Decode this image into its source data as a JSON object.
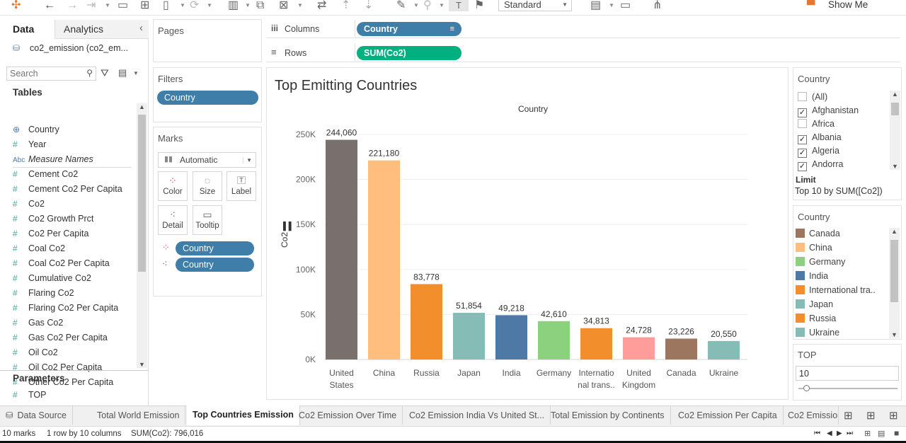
{
  "toolbar": {
    "fit_select": "Standard",
    "show_me": "Show Me"
  },
  "data_pane": {
    "tabs": [
      "Data",
      "Analytics"
    ],
    "datasource": "co2_emission (co2_em...",
    "search_placeholder": "Search",
    "tables_heading": "Tables",
    "fields": [
      {
        "type": "geo",
        "name": "Country"
      },
      {
        "type": "#",
        "name": "Year"
      },
      {
        "type": "Abc",
        "name": "Measure Names"
      },
      {
        "type": "#",
        "name": "Cement Co2"
      },
      {
        "type": "#",
        "name": "Cement Co2 Per Capita"
      },
      {
        "type": "#",
        "name": "Co2"
      },
      {
        "type": "#",
        "name": "Co2 Growth Prct"
      },
      {
        "type": "#",
        "name": "Co2 Per Capita"
      },
      {
        "type": "#",
        "name": "Coal Co2"
      },
      {
        "type": "#",
        "name": "Coal Co2 Per Capita"
      },
      {
        "type": "#",
        "name": "Cumulative Co2"
      },
      {
        "type": "#",
        "name": "Flaring Co2"
      },
      {
        "type": "#",
        "name": "Flaring Co2 Per Capita"
      },
      {
        "type": "#",
        "name": "Gas Co2"
      },
      {
        "type": "#",
        "name": "Gas Co2 Per Capita"
      },
      {
        "type": "#",
        "name": "Oil Co2"
      },
      {
        "type": "#",
        "name": "Oil Co2 Per Capita"
      },
      {
        "type": "#",
        "name": "Other Co2 Per Capita"
      }
    ],
    "parameters_heading": "Parameters",
    "parameters": [
      {
        "type": "#",
        "name": "TOP"
      }
    ]
  },
  "pages_label": "Pages",
  "filters_label": "Filters",
  "filters_pill": "Country",
  "marks": {
    "label": "Marks",
    "type": "Automatic",
    "buttons": [
      "Color",
      "Size",
      "Label",
      "Detail",
      "Tooltip"
    ],
    "pills": [
      "Country",
      "Country"
    ]
  },
  "shelves": {
    "columns_label": "Columns",
    "columns_pill": "Country",
    "rows_label": "Rows",
    "rows_pill": "SUM(Co2)"
  },
  "chart_data": {
    "type": "bar",
    "title": "Top Emitting Countries",
    "header": "Country",
    "ylabel": "Co2",
    "ylim": [
      0,
      250000
    ],
    "yticks": [
      "0K",
      "50K",
      "100K",
      "150K",
      "200K",
      "250K"
    ],
    "categories": [
      "United States",
      "China",
      "Russia",
      "Japan",
      "India",
      "Germany",
      "International trans..",
      "United Kingdom",
      "Canada",
      "Ukraine"
    ],
    "category_lines": [
      [
        "United",
        "States"
      ],
      [
        "China"
      ],
      [
        "Russia"
      ],
      [
        "Japan"
      ],
      [
        "India"
      ],
      [
        "Germany"
      ],
      [
        "Internatio",
        "nal trans.."
      ],
      [
        "United",
        "Kingdom"
      ],
      [
        "Canada"
      ],
      [
        "Ukraine"
      ]
    ],
    "values": [
      244060,
      221180,
      83778,
      51854,
      49218,
      42610,
      34813,
      24728,
      23226,
      20550
    ],
    "labels": [
      "244,060",
      "221,180",
      "83,778",
      "51,854",
      "49,218",
      "42,610",
      "34,813",
      "24,728",
      "23,226",
      "20,550"
    ],
    "colors": [
      "#79706e",
      "#ffbe7d",
      "#f28e2b",
      "#86bcb6",
      "#4e79a7",
      "#8cd17d",
      "#f28e2b",
      "#ff9d9a",
      "#9d7660",
      "#86bcb6"
    ]
  },
  "filter_card": {
    "title": "Country",
    "items": [
      {
        "label": "(All)",
        "checked": false
      },
      {
        "label": "Afghanistan",
        "checked": true
      },
      {
        "label": "Africa",
        "checked": false
      },
      {
        "label": "Albania",
        "checked": true
      },
      {
        "label": "Algeria",
        "checked": true
      },
      {
        "label": "Andorra",
        "checked": true
      }
    ],
    "limit_label": "Limit",
    "limit_text": "Top 10 by SUM([Co2])"
  },
  "legend": {
    "title": "Country",
    "items": [
      {
        "label": "Canada",
        "color": "#9d7660"
      },
      {
        "label": "China",
        "color": "#ffbe7d"
      },
      {
        "label": "Germany",
        "color": "#8cd17d"
      },
      {
        "label": "India",
        "color": "#4e79a7"
      },
      {
        "label": "International tra..",
        "color": "#f28e2b"
      },
      {
        "label": "Japan",
        "color": "#86bcb6"
      },
      {
        "label": "Russia",
        "color": "#f28e2b"
      },
      {
        "label": "Ukraine",
        "color": "#86bcb6"
      }
    ]
  },
  "parameter_card": {
    "title": "TOP",
    "value": "10"
  },
  "sheet_tabs": [
    "Data Source",
    "Total World Emission",
    "Top Countries Emission",
    "Co2 Emission Over Time",
    "Co2 Emission India Vs United St...",
    "Total Emission by Continents",
    "Co2 Emission Per Capita",
    "Co2 Emissio"
  ],
  "status": {
    "marks": "10 marks",
    "layout": "1 row by 10 columns",
    "sum": "SUM(Co2): 796,016"
  }
}
